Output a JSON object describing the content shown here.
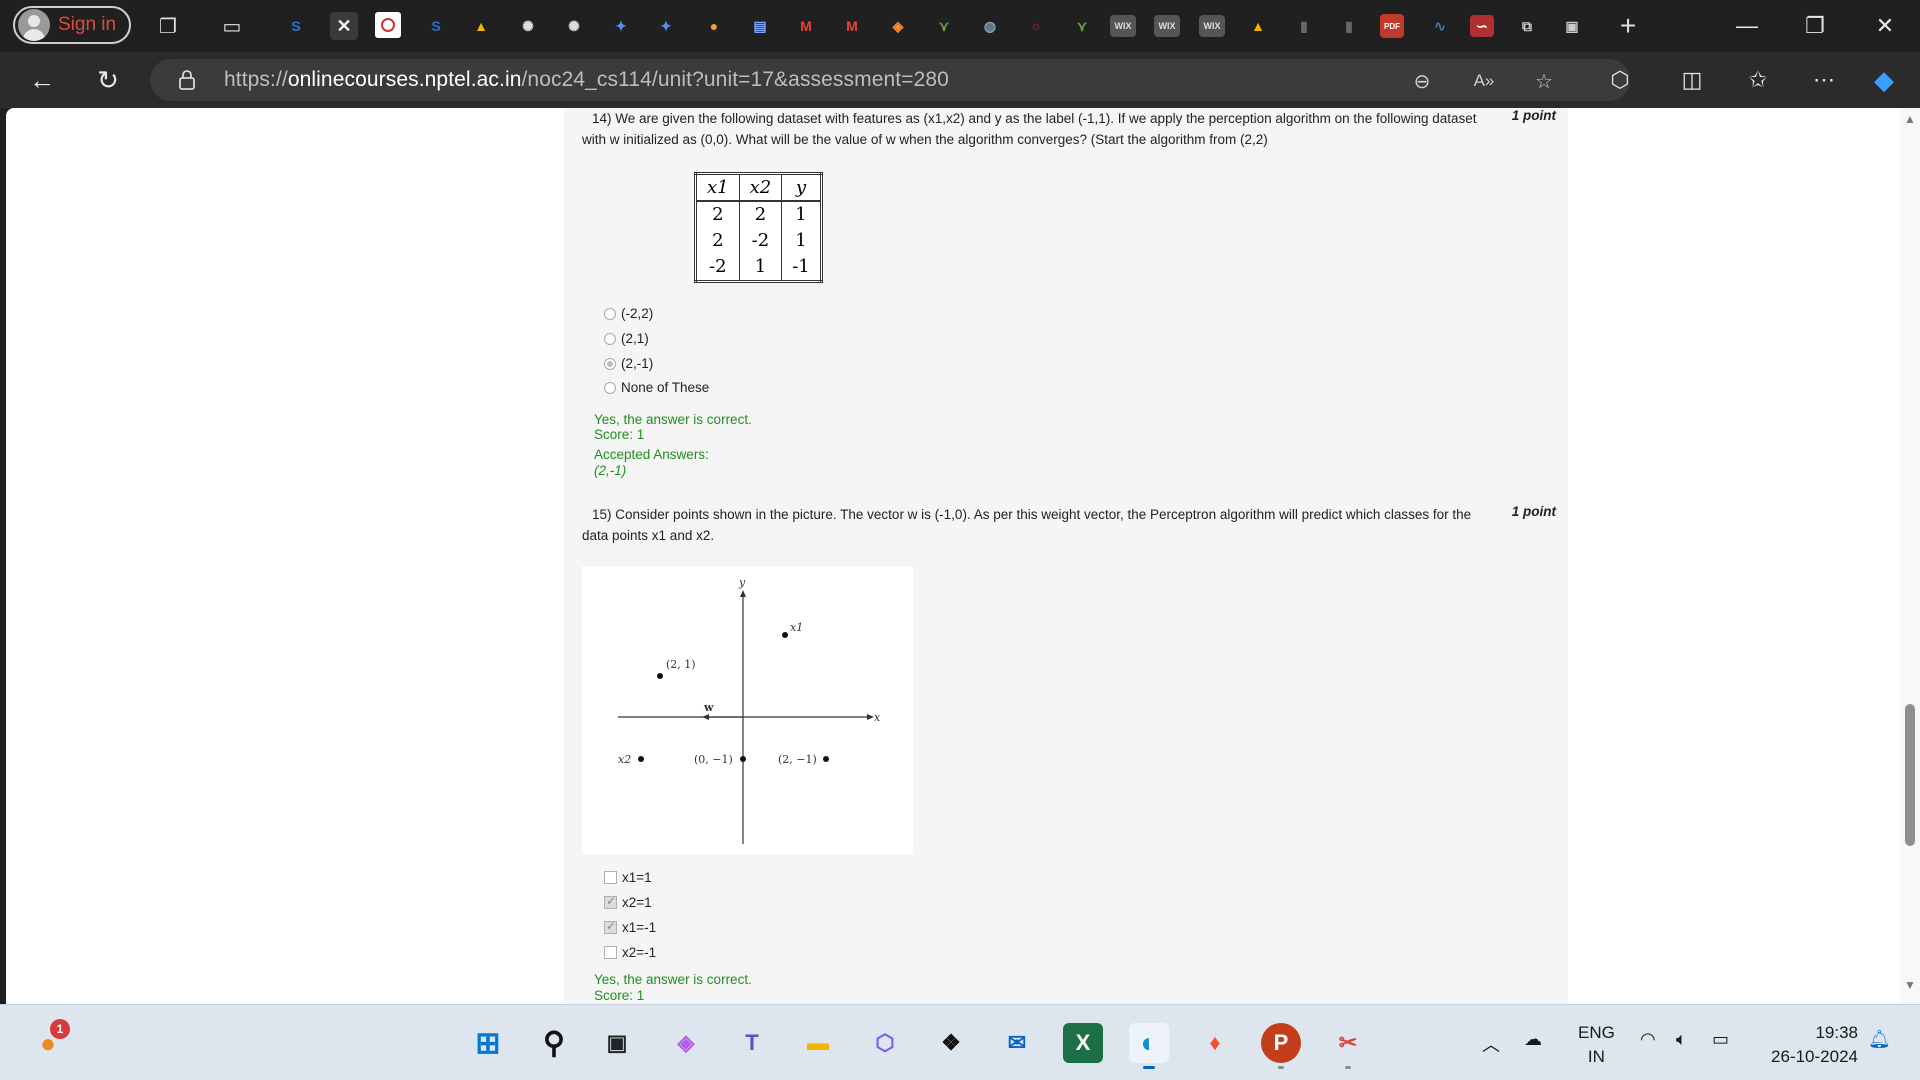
{
  "browser": {
    "signin_label": "Sign in",
    "tab_badges": [
      "S",
      "S",
      "WIX",
      "WIX",
      "WIX",
      "PDF"
    ],
    "address": {
      "url_prefix": "https://",
      "url_host": "onlinecourses.nptel.ac.in",
      "url_path": "/noc24_cs114/unit?unit=17&assessment=280"
    }
  },
  "page": {
    "q14": {
      "number": "14)",
      "text": "We are given the following dataset with features as (x1,x2) and y as the label (-1,1). If we apply the perception algorithm on the following dataset with w initialized as (0,0). What will be the value of w when the algorithm converges? (Start the algorithm from (2,2)",
      "points": "1 point",
      "table": {
        "headers": [
          "x1",
          "x2",
          "y"
        ],
        "rows": [
          [
            "2",
            "2",
            "1"
          ],
          [
            "2",
            "-2",
            "1"
          ],
          [
            "-2",
            "1",
            "-1"
          ]
        ]
      },
      "options": [
        {
          "label": "(-2,2)",
          "selected": false
        },
        {
          "label": "(2,1)",
          "selected": false
        },
        {
          "label": "(2,-1)",
          "selected": true
        },
        {
          "label": "None of These",
          "selected": false
        }
      ],
      "feedback": "Yes, the answer is correct.",
      "score": "Score: 1",
      "accepted_label": "Accepted Answers:",
      "accepted_value": "(2,-1)"
    },
    "q15": {
      "number": "15)",
      "text": "Consider points shown in the picture. The vector w is (-1,0). As per this weight vector, the Perceptron algorithm will predict which classes for the data points x1 and x2.",
      "points": "1 point",
      "figure_labels": {
        "y_axis": "y",
        "x_axis": "x",
        "w": "w",
        "p_x1": "x1",
        "p_21": "(2, 1)",
        "p_x2": "x2",
        "p_0m1": "(0, −1)",
        "p_2m1": "(2, −1)"
      },
      "options": [
        {
          "label": "x1=1",
          "selected": false
        },
        {
          "label": "x2=1",
          "selected": true
        },
        {
          "label": "x1=-1",
          "selected": true
        },
        {
          "label": "x2=-1",
          "selected": false
        }
      ],
      "feedback": "Yes, the answer is correct.",
      "score": "Score: 1"
    }
  },
  "taskbar": {
    "notification_count": "1",
    "lang_top": "ENG",
    "lang_bottom": "IN",
    "time": "19:38",
    "date": "26-10-2024"
  },
  "colors": {
    "correct_green": "#1e8f1e",
    "browser_dark": "#202020",
    "taskbar": "#dde5ef"
  }
}
